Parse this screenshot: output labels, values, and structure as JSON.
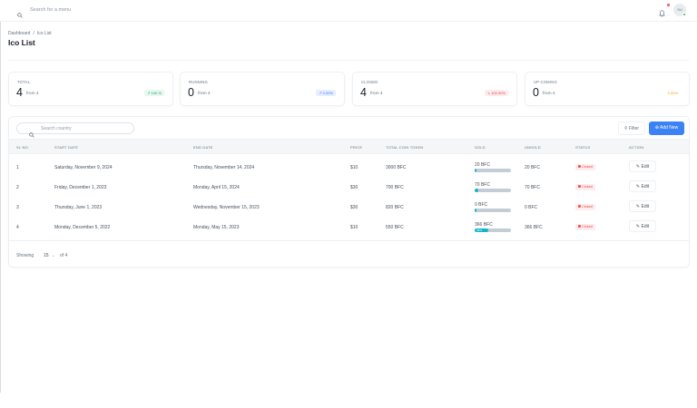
{
  "topbar": {
    "search_placeholder": "Search for a menu",
    "avatar_initials": "SU"
  },
  "breadcrumb": {
    "home": "Dashboard",
    "separator": "/",
    "current": "Ico List"
  },
  "page_title": "Ico List",
  "stats": [
    {
      "label": "TOTAL",
      "value": "4",
      "sub": "from 4",
      "badge": "100 %",
      "badge_color": "#22a06b"
    },
    {
      "label": "RUNNING",
      "value": "0",
      "sub": "from 4",
      "badge": "0.00%",
      "badge_color": "#3b82f6"
    },
    {
      "label": "CLOSED",
      "value": "4",
      "sub": "from 4",
      "badge": "100.00%",
      "badge_color": "#ef4444"
    },
    {
      "label": "UP COMING",
      "value": "0",
      "sub": "from 4",
      "badge": "0.00%",
      "badge_color": "#f59e0b"
    }
  ],
  "table": {
    "search_placeholder": "Search country",
    "filter_label": "Filter",
    "add_label": "Add New",
    "headers": [
      "SL NO.",
      "START DATE",
      "END DATE",
      "PRICE",
      "TOTAL COIN TOKEN",
      "SOLD",
      "UNSOLD",
      "STATUS",
      "ACTION"
    ],
    "rows": [
      {
        "sl": "1",
        "start": "Saturday, November 9, 2024",
        "end": "Thursday, November 14, 2024",
        "price": "$10",
        "total": "3000 BFC",
        "sold": "20 BFC",
        "sold_pct": 0,
        "sold_pct_label": "",
        "unsold": "20 BFC",
        "status": "Closed",
        "action": "Edit"
      },
      {
        "sl": "2",
        "start": "Friday, December 1, 2023",
        "end": "Monday, April 15, 2024",
        "price": "$30",
        "total": "700 BFC",
        "sold": "70 BFC",
        "sold_pct": 10,
        "sold_pct_label": "",
        "unsold": "70 BFC",
        "status": "Closed",
        "action": "Edit"
      },
      {
        "sl": "3",
        "start": "Thursday, June 1, 2023",
        "end": "Wednesday, November 15, 2023",
        "price": "$30",
        "total": "820 BFC",
        "sold": "0 BFC",
        "sold_pct": 0,
        "sold_pct_label": "",
        "unsold": "0 BFC",
        "status": "Closed",
        "action": "Edit"
      },
      {
        "sl": "4",
        "start": "Monday, December 5, 2022",
        "end": "Monday, May 15, 2023",
        "price": "$10",
        "total": "550 BFC",
        "sold": "366 BFC",
        "sold_pct": 38,
        "sold_pct_label": "38%",
        "unsold": "366 BFC",
        "status": "Closed",
        "action": "Edit"
      }
    ],
    "footer": {
      "showing_label": "Showing",
      "per_page": "15",
      "of_label": "of",
      "total": "4"
    }
  }
}
